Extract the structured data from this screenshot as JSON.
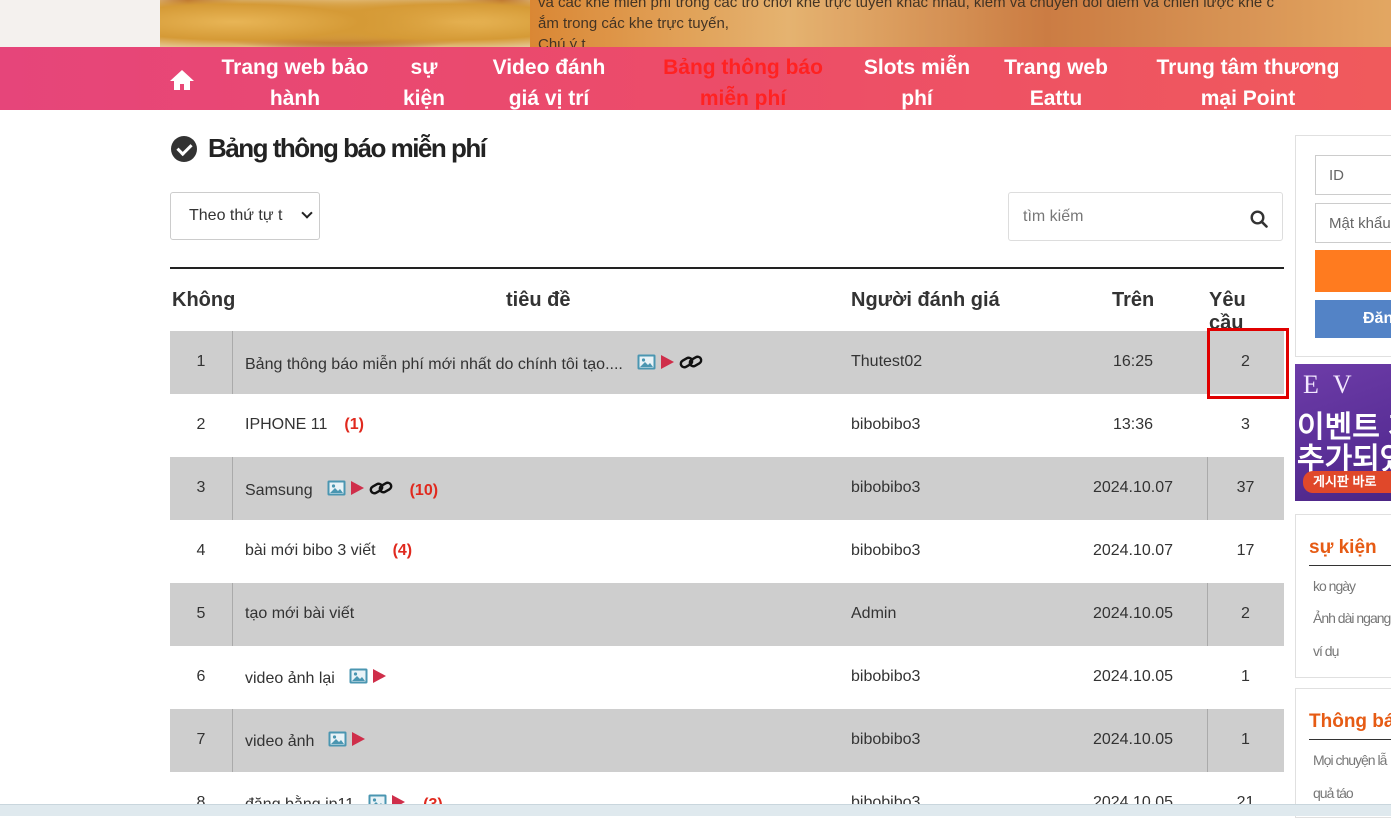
{
  "banner": {
    "lines": [
      "và các khe miễn phí trong các trò chơi khe trực tuyến khác nhau, kiếm và chuyển đổi điểm và chiến lược khe c",
      "ắm trong các khe trực tuyến,",
      "Chú ý t..."
    ]
  },
  "nav": {
    "items": [
      {
        "label1": "Trang web bảo",
        "label2": "hành"
      },
      {
        "label1": "sự",
        "label2": "kiện"
      },
      {
        "label1": "Video đánh",
        "label2": "giá vị trí"
      },
      {
        "label1": "Bảng thông báo",
        "label2": "miễn phí"
      },
      {
        "label1": "Slots miễn",
        "label2": "phí"
      },
      {
        "label1": "Trang web",
        "label2": "Eattu"
      },
      {
        "label1": "Trung tâm thương",
        "label2": "mại Point"
      }
    ]
  },
  "page": {
    "title": "Bảng thông báo miễn phí",
    "sort_value": "Theo thứ tự t",
    "search_placeholder": "tìm kiếm"
  },
  "table": {
    "headers": {
      "no": "Không",
      "title": "tiêu đề",
      "author": "Người đánh giá",
      "date": "Trên",
      "req": "Yêu cầu"
    },
    "rows": [
      {
        "no": "1",
        "title": "Bảng thông báo miễn phí mới nhất do chính tôi tạo....",
        "comments": "",
        "author": "Thutest02",
        "date": "16:25",
        "req": "2",
        "icons": [
          "image",
          "video",
          "link"
        ]
      },
      {
        "no": "2",
        "title": "IPHONE 11",
        "comments": "(1)",
        "author": "bibobibo3",
        "date": "13:36",
        "req": "3",
        "icons": []
      },
      {
        "no": "3",
        "title": "Samsung",
        "comments": "(10)",
        "author": "bibobibo3",
        "date": "2024.10.07",
        "req": "37",
        "icons": [
          "image",
          "video",
          "link"
        ]
      },
      {
        "no": "4",
        "title": "bài mới bibo 3 viết",
        "comments": "(4)",
        "author": "bibobibo3",
        "date": "2024.10.07",
        "req": "17",
        "icons": []
      },
      {
        "no": "5",
        "title": "tạo mới bài viết",
        "comments": "",
        "author": "Admin",
        "date": "2024.10.05",
        "req": "2",
        "icons": []
      },
      {
        "no": "6",
        "title": "video ảnh lại",
        "comments": "",
        "author": "bibobibo3",
        "date": "2024.10.05",
        "req": "1",
        "icons": [
          "image",
          "video"
        ]
      },
      {
        "no": "7",
        "title": "video ảnh",
        "comments": "",
        "author": "bibobibo3",
        "date": "2024.10.05",
        "req": "1",
        "icons": [
          "image",
          "video"
        ]
      },
      {
        "no": "8",
        "title": "đăng bằng ip11",
        "comments": "(3)",
        "author": "bibobibo3",
        "date": "2024.10.05",
        "req": "21",
        "icons": [
          "image",
          "video"
        ]
      }
    ]
  },
  "sidebar": {
    "login": {
      "id_placeholder": "ID",
      "pw_placeholder": "Mật khẩu",
      "signup_label": "Đăng"
    },
    "event_banner": {
      "ev": "EV",
      "line1": "이벤트 게",
      "line2": "추가되었",
      "line3": "게시판 바로"
    },
    "events": {
      "heading": "sự kiện",
      "items": [
        "ko ngày",
        "Ảnh dài ngang",
        "ví dụ"
      ]
    },
    "notices": {
      "heading": "Thông bá",
      "items": [
        "Mọi chuyện lẫ",
        "quả táo"
      ]
    }
  },
  "colors": {
    "nav_active": "#ff2222",
    "comment_count": "#e0291e",
    "highlight_box": "#e00000",
    "login_button": "#ff7b1f",
    "signup_button": "#5383c6"
  }
}
